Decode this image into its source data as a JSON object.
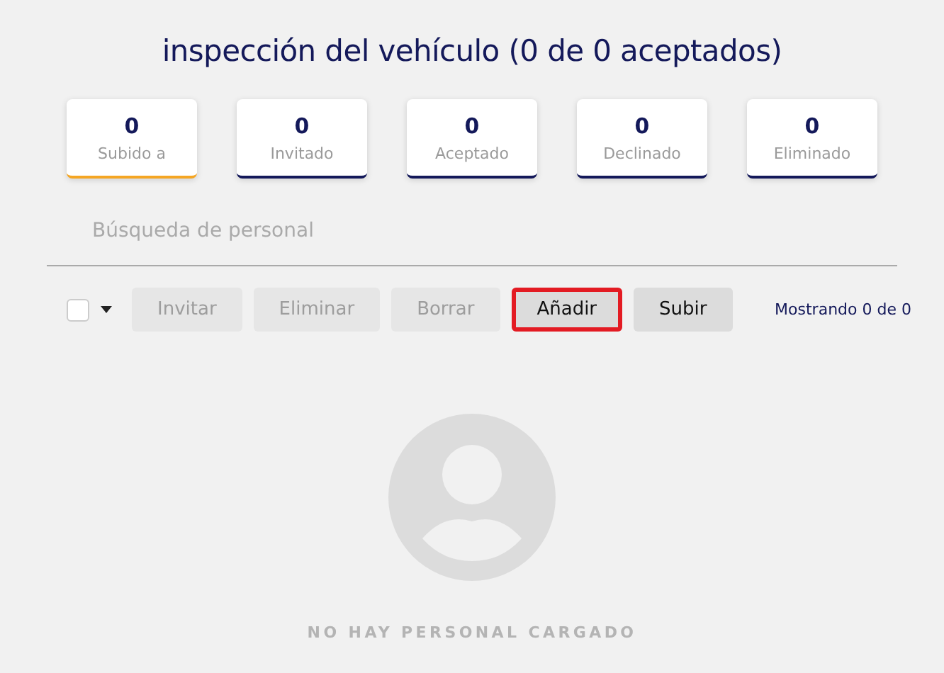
{
  "title": "inspección del vehículo (0 de 0 aceptados)",
  "stats": [
    {
      "count": "0",
      "label": "Subido a",
      "selected": true
    },
    {
      "count": "0",
      "label": "Invitado",
      "selected": false
    },
    {
      "count": "0",
      "label": "Aceptado",
      "selected": false
    },
    {
      "count": "0",
      "label": "Declinado",
      "selected": false
    },
    {
      "count": "0",
      "label": "Eliminado",
      "selected": false
    }
  ],
  "search": {
    "placeholder": "Búsqueda de personal"
  },
  "select_all": {
    "checked": false
  },
  "buttons": [
    {
      "label": "Invitar",
      "disabled": true,
      "highlighted": false
    },
    {
      "label": "Eliminar",
      "disabled": true,
      "highlighted": false
    },
    {
      "label": "Borrar",
      "disabled": true,
      "highlighted": false
    },
    {
      "label": "Añadir",
      "disabled": false,
      "highlighted": true
    },
    {
      "label": "Subir",
      "disabled": false,
      "highlighted": false
    }
  ],
  "showing": "Mostrando 0 de 0",
  "empty_message": "NO HAY PERSONAL CARGADO"
}
